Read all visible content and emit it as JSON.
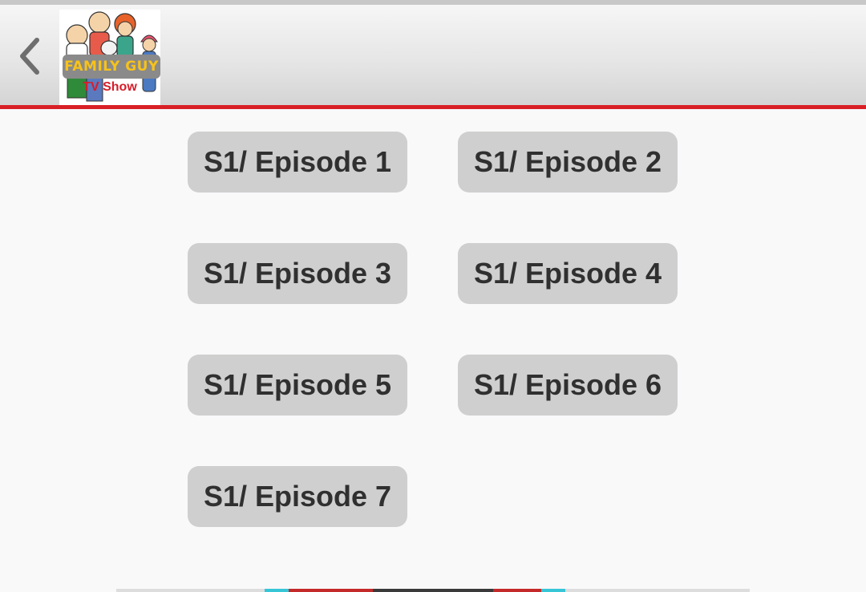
{
  "header": {
    "back_icon": "chevron-left-icon",
    "logo": {
      "title": "FAMILY GUY",
      "subtitle": "TV Show"
    }
  },
  "episodes": [
    {
      "label": "S1/ Episode 1"
    },
    {
      "label": "S1/ Episode 2"
    },
    {
      "label": "S1/ Episode 3"
    },
    {
      "label": "S1/ Episode 4"
    },
    {
      "label": "S1/ Episode 5"
    },
    {
      "label": "S1/ Episode 6"
    },
    {
      "label": "S1/ Episode 7"
    }
  ],
  "colors": {
    "accent": "#d81f26",
    "button_bg": "#cfcfcf",
    "button_text": "#303030",
    "logo_title": "#f7c21a"
  }
}
